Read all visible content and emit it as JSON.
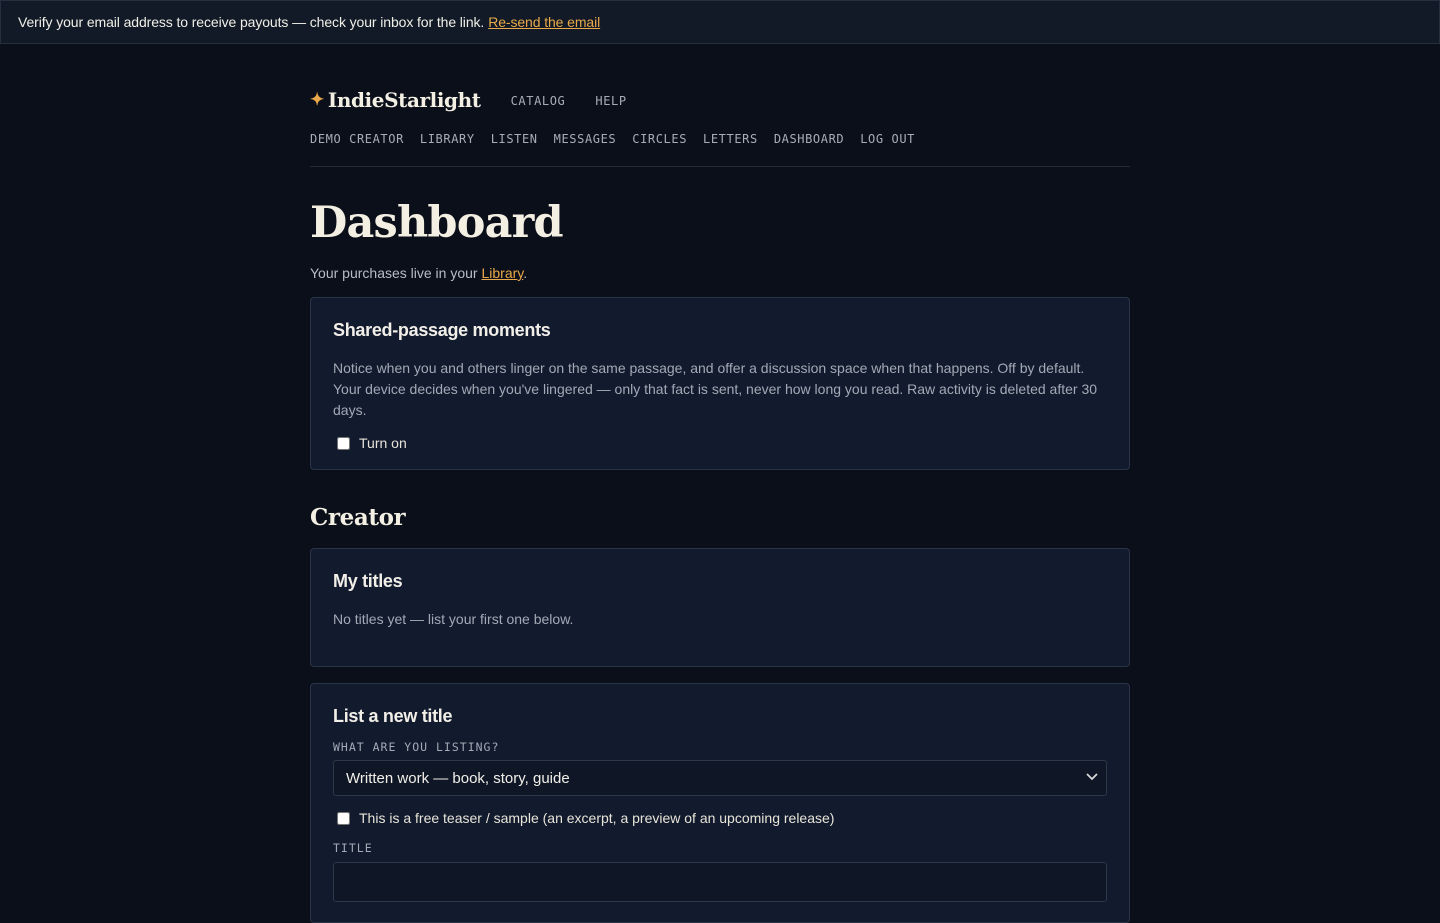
{
  "banner": {
    "text": "Verify your email address to receive payouts — check your inbox for the link.",
    "link_label": "Re-send the email"
  },
  "brand": {
    "icon": "star-icon",
    "name": "IndieStarlight"
  },
  "topnav": [
    "CATALOG",
    "HELP"
  ],
  "subnav": [
    "DEMO CREATOR",
    "LIBRARY",
    "LISTEN",
    "MESSAGES",
    "CIRCLES",
    "LETTERS",
    "DASHBOARD",
    "LOG OUT"
  ],
  "page": {
    "title": "Dashboard",
    "lede_prefix": "Your purchases live in your",
    "lede_link": "Library",
    "lede_suffix": "."
  },
  "shared_moments": {
    "title": "Shared-passage moments",
    "description": "Notice when you and others linger on the same passage, and offer a discussion space when that happens. Off by default. Your device decides when you've lingered — only that fact is sent, never how long you read. Raw activity is deleted after 30 days.",
    "toggle_label": "Turn on",
    "toggle_checked": false
  },
  "creator": {
    "heading": "Creator",
    "my_titles": {
      "title": "My titles",
      "empty_text": "No titles yet — list your first one below."
    },
    "new_title": {
      "title": "List a new title",
      "type_label": "WHAT ARE YOU LISTING?",
      "type_value": "Written work — book, story, guide",
      "teaser_label": "This is a free teaser / sample (an excerpt, a preview of an upcoming release)",
      "teaser_checked": false,
      "title_label": "TITLE",
      "title_value": ""
    }
  },
  "colors": {
    "accent": "#e9a94a",
    "background": "#0b0f1a",
    "card": "#121a2e"
  }
}
